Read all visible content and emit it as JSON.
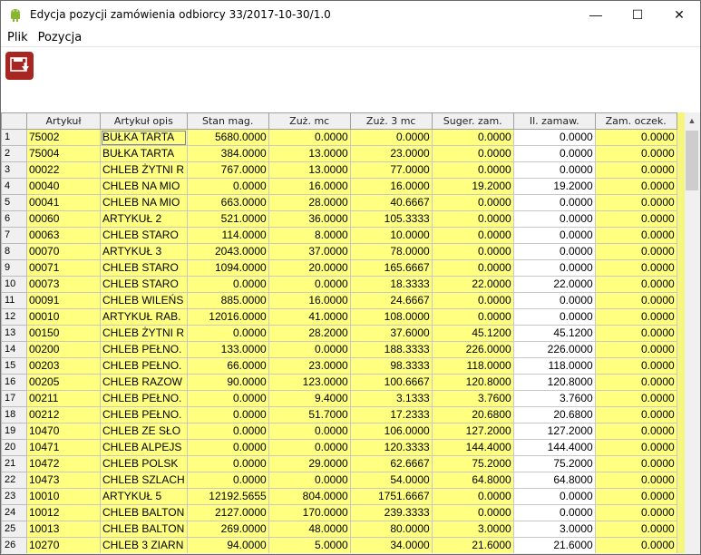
{
  "window": {
    "title": "Edycja pozycji zamówienia odbiorcy 33/2017-10-30/1.0",
    "minimize": "—",
    "maximize": "☐",
    "close": "✕"
  },
  "menu": {
    "file": "Plik",
    "position": "Pozycja"
  },
  "toolbar": {
    "save_icon": "save-icon"
  },
  "grid": {
    "headers": [
      "",
      "Artykuł",
      "Artykuł opis",
      "Stan mag.",
      "Zuż. mc",
      "Zuż. 3 mc",
      "Suger. zam.",
      "Il. zamaw.",
      "Zam. oczek."
    ],
    "rows": [
      [
        "1",
        "75002",
        "BUŁKA TARTA",
        "5680.0000",
        "0.0000",
        "0.0000",
        "0.0000",
        "0.0000",
        "0.0000"
      ],
      [
        "2",
        "75004",
        "BUŁKA TARTA",
        "384.0000",
        "13.0000",
        "23.0000",
        "0.0000",
        "0.0000",
        "0.0000"
      ],
      [
        "3",
        "00022",
        "CHLEB ŻYTNI R",
        "767.0000",
        "13.0000",
        "77.0000",
        "0.0000",
        "0.0000",
        "0.0000"
      ],
      [
        "4",
        "00040",
        "CHLEB NA MIO",
        "0.0000",
        "16.0000",
        "16.0000",
        "19.2000",
        "19.2000",
        "0.0000"
      ],
      [
        "5",
        "00041",
        "CHLEB NA MIO",
        "663.0000",
        "28.0000",
        "40.6667",
        "0.0000",
        "0.0000",
        "0.0000"
      ],
      [
        "6",
        "00060",
        "ARTYKUŁ 2",
        "521.0000",
        "36.0000",
        "105.3333",
        "0.0000",
        "0.0000",
        "0.0000"
      ],
      [
        "7",
        "00063",
        "CHLEB STARO",
        "114.0000",
        "8.0000",
        "10.0000",
        "0.0000",
        "0.0000",
        "0.0000"
      ],
      [
        "8",
        "00070",
        "ARTYKUŁ 3",
        "2043.0000",
        "37.0000",
        "78.0000",
        "0.0000",
        "0.0000",
        "0.0000"
      ],
      [
        "9",
        "00071",
        "CHLEB STARO",
        "1094.0000",
        "20.0000",
        "165.6667",
        "0.0000",
        "0.0000",
        "0.0000"
      ],
      [
        "10",
        "00073",
        "CHLEB STARO",
        "0.0000",
        "0.0000",
        "18.3333",
        "22.0000",
        "22.0000",
        "0.0000"
      ],
      [
        "11",
        "00091",
        "CHLEB WILEŃS",
        "885.0000",
        "16.0000",
        "24.6667",
        "0.0000",
        "0.0000",
        "0.0000"
      ],
      [
        "12",
        "00010",
        "ARTYKUŁ RAB.",
        "12016.0000",
        "41.0000",
        "108.0000",
        "0.0000",
        "0.0000",
        "0.0000"
      ],
      [
        "13",
        "00150",
        "CHLEB ŻYTNI R",
        "0.0000",
        "28.2000",
        "37.6000",
        "45.1200",
        "45.1200",
        "0.0000"
      ],
      [
        "14",
        "00200",
        "CHLEB PEŁNO.",
        "133.0000",
        "0.0000",
        "188.3333",
        "226.0000",
        "226.0000",
        "0.0000"
      ],
      [
        "15",
        "00203",
        "CHLEB PEŁNO.",
        "66.0000",
        "23.0000",
        "98.3333",
        "118.0000",
        "118.0000",
        "0.0000"
      ],
      [
        "16",
        "00205",
        "CHLEB RAZOW",
        "90.0000",
        "123.0000",
        "100.6667",
        "120.8000",
        "120.8000",
        "0.0000"
      ],
      [
        "17",
        "00211",
        "CHLEB PEŁNO.",
        "0.0000",
        "9.4000",
        "3.1333",
        "3.7600",
        "3.7600",
        "0.0000"
      ],
      [
        "18",
        "00212",
        "CHLEB PEŁNO.",
        "0.0000",
        "51.7000",
        "17.2333",
        "20.6800",
        "20.6800",
        "0.0000"
      ],
      [
        "19",
        "10470",
        "CHLEB ZE SŁO",
        "0.0000",
        "0.0000",
        "106.0000",
        "127.2000",
        "127.2000",
        "0.0000"
      ],
      [
        "20",
        "10471",
        "CHLEB ALPEJS",
        "0.0000",
        "0.0000",
        "120.3333",
        "144.4000",
        "144.4000",
        "0.0000"
      ],
      [
        "21",
        "10472",
        "CHLEB POLSK",
        "0.0000",
        "29.0000",
        "62.6667",
        "75.2000",
        "75.2000",
        "0.0000"
      ],
      [
        "22",
        "10473",
        "CHLEB SZLACH",
        "0.0000",
        "0.0000",
        "54.0000",
        "64.8000",
        "64.8000",
        "0.0000"
      ],
      [
        "23",
        "10010",
        "ARTYKUŁ 5",
        "12192.5655",
        "804.0000",
        "1751.6667",
        "0.0000",
        "0.0000",
        "0.0000"
      ],
      [
        "24",
        "10012",
        "CHLEB BALTON",
        "2127.0000",
        "170.0000",
        "239.3333",
        "0.0000",
        "0.0000",
        "0.0000"
      ],
      [
        "25",
        "10013",
        "CHLEB BALTON",
        "269.0000",
        "48.0000",
        "80.0000",
        "3.0000",
        "3.0000",
        "0.0000"
      ],
      [
        "26",
        "10270",
        "CHLEB 3 ZIARN",
        "94.0000",
        "5.0000",
        "34.0000",
        "21.6000",
        "21.6000",
        "0.0000"
      ]
    ]
  },
  "colors": {
    "row_bg": "#ffff80",
    "editable_bg": "#ffffff",
    "toolbar_button": "#a82622"
  }
}
